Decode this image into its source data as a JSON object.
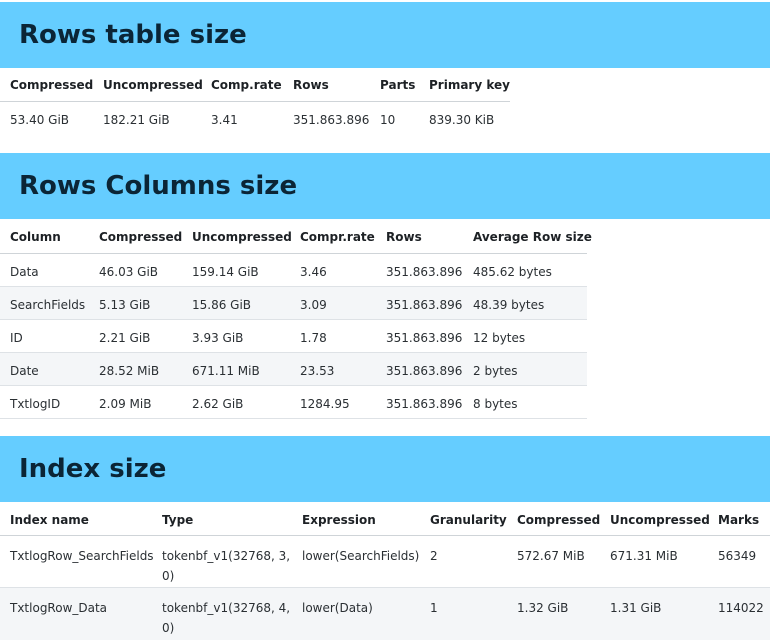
{
  "sections": [
    {
      "title": "Rows table size",
      "columns": [
        "Compressed",
        "Uncompressed",
        "Comp.rate",
        "Rows",
        "Parts",
        "Primary key"
      ],
      "rows": [
        [
          "53.40 GiB",
          "182.21 GiB",
          "3.41",
          "351.863.896",
          "10",
          "839.30 KiB"
        ]
      ]
    },
    {
      "title": "Rows Columns size",
      "columns": [
        "Column",
        "Compressed",
        "Uncompressed",
        "Compr.rate",
        "Rows",
        "Average Row size"
      ],
      "rows": [
        [
          "Data",
          "46.03 GiB",
          "159.14 GiB",
          "3.46",
          "351.863.896",
          "485.62 bytes"
        ],
        [
          "SearchFields",
          "5.13 GiB",
          "15.86 GiB",
          "3.09",
          "351.863.896",
          "48.39 bytes"
        ],
        [
          "ID",
          "2.21 GiB",
          "3.93 GiB",
          "1.78",
          "351.863.896",
          "12 bytes"
        ],
        [
          "Date",
          "28.52 MiB",
          "671.11 MiB",
          "23.53",
          "351.863.896",
          "2 bytes"
        ],
        [
          "TxtlogID",
          "2.09 MiB",
          "2.62 GiB",
          "1284.95",
          "351.863.896",
          "8 bytes"
        ]
      ]
    },
    {
      "title": "Index size",
      "columns": [
        "Index name",
        "Type",
        "Expression",
        "Granularity",
        "Compressed",
        "Uncompressed",
        "Marks"
      ],
      "rows": [
        [
          "TxtlogRow_SearchFields",
          "tokenbf_v1(32768, 3, 0)",
          "lower(SearchFields)",
          "2",
          "572.67 MiB",
          "671.31 MiB",
          "56349"
        ],
        [
          "TxtlogRow_Data",
          "tokenbf_v1(32768, 4, 0)",
          "lower(Data)",
          "1",
          "1.32 GiB",
          "1.31 GiB",
          "114022"
        ]
      ]
    }
  ]
}
